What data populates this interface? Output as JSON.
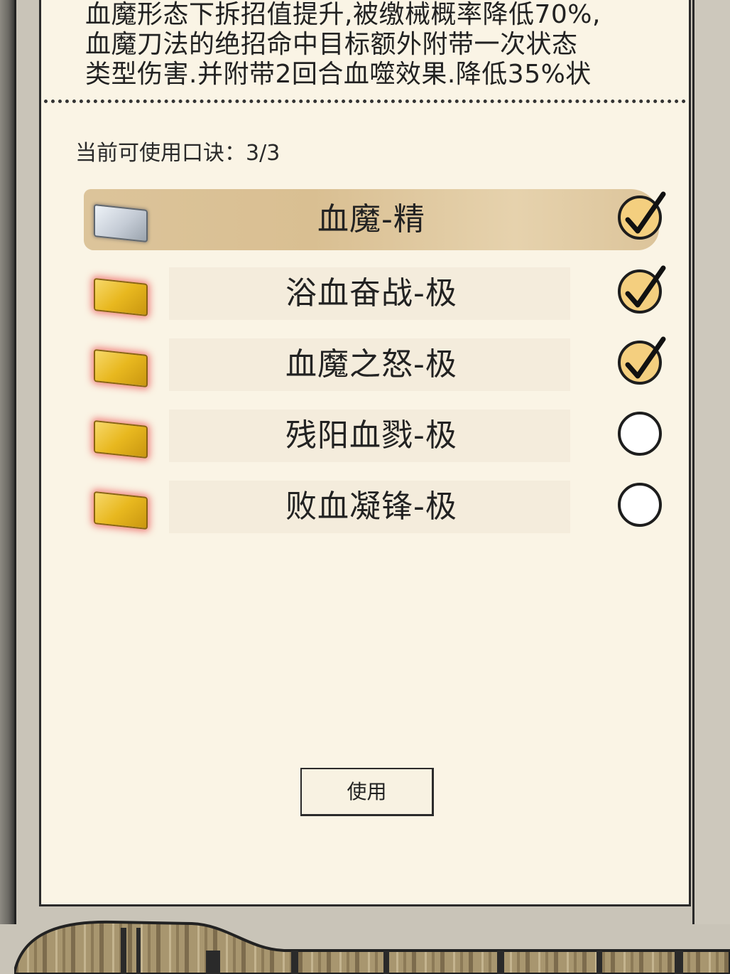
{
  "description": {
    "lines": [
      "血魔形态下拆招值提升,被缴械概率降低70%,",
      "血魔刀法的绝招命中目标额外附带一次状态",
      "类型伤害.并附带2回合血噬效果.降低35%状"
    ]
  },
  "usable": {
    "label": "当前可使用口诀：",
    "count": "3/3"
  },
  "slots": [
    {
      "name": "血魔-精",
      "token": "silver",
      "checked": true,
      "selected": true
    },
    {
      "name": "浴血奋战-极",
      "token": "gold",
      "checked": true,
      "selected": false
    },
    {
      "name": "血魔之怒-极",
      "token": "gold",
      "checked": true,
      "selected": false
    },
    {
      "name": "残阳血戮-极",
      "token": "gold",
      "checked": false,
      "selected": false
    },
    {
      "name": "败血凝锋-极",
      "token": "gold",
      "checked": false,
      "selected": false
    }
  ],
  "use_button": {
    "label": "使用"
  },
  "colors": {
    "panel": "#faf4e5",
    "selected_row": "#dcc49a",
    "check_fill": "#f4cf7f",
    "gold_token": "#e8b81f",
    "silver_token": "#c5ccd6"
  }
}
